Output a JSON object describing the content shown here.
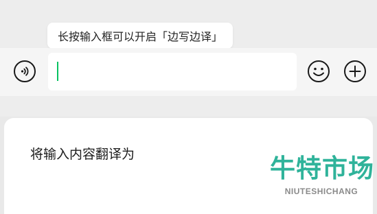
{
  "tooltip": {
    "text": "长按输入框可以开启「边写边译」"
  },
  "input_bar": {
    "voice_icon": "voice-wave-icon",
    "input_value": "",
    "emoji_icon": "smiley-face-icon",
    "more_icon": "plus-circle-icon",
    "caret_color": "#07c160"
  },
  "sheet": {
    "title": "将输入内容翻译为"
  },
  "watermark": {
    "brand_cn": "牛特市场",
    "brand_en": "NIUTESHICHANG",
    "color": "#2fb39a"
  }
}
